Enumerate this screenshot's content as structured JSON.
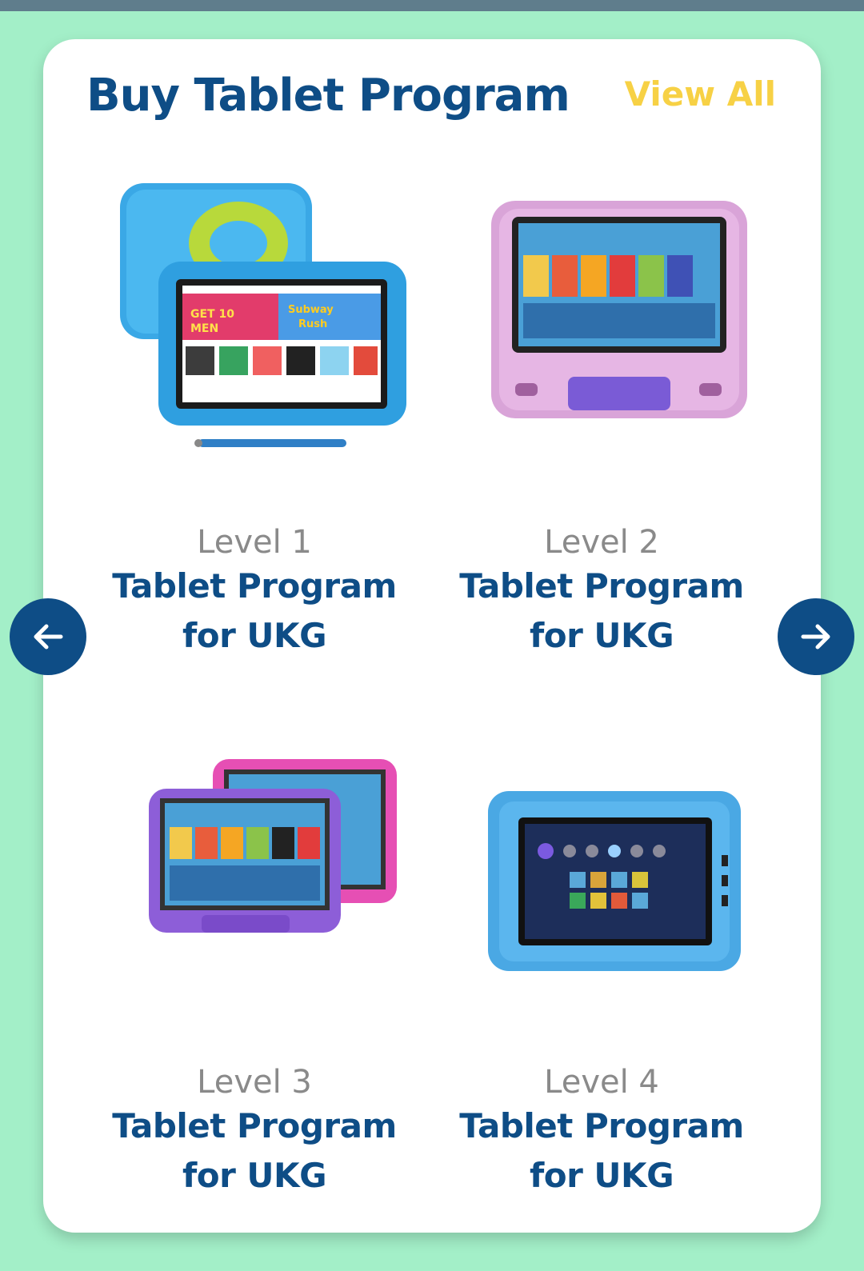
{
  "section": {
    "title": "Buy Tablet Program",
    "view_all": "View All"
  },
  "products": [
    {
      "level": "Level 1",
      "name_line1": "Tablet Program",
      "name_line2": "for UKG",
      "image": "blue kids tablet with stylus"
    },
    {
      "level": "Level 2",
      "name_line1": "Tablet Program",
      "name_line2": "for UKG",
      "image": "pink kids tablet with stand"
    },
    {
      "level": "Level 3",
      "name_line1": "Tablet Program",
      "name_line2": "for UKG",
      "image": "purple and pink kids tablets"
    },
    {
      "level": "Level 4",
      "name_line1": "Tablet Program",
      "name_line2": "for UKG",
      "image": "blue rugged kids tablet"
    }
  ],
  "icons": {
    "prev": "arrow-left-icon",
    "next": "arrow-right-icon"
  },
  "colors": {
    "background": "#a3efc8",
    "title": "#0e4d86",
    "view_all": "#f7d145",
    "level": "#8a8a8a",
    "nav_button": "#0e4d86"
  }
}
